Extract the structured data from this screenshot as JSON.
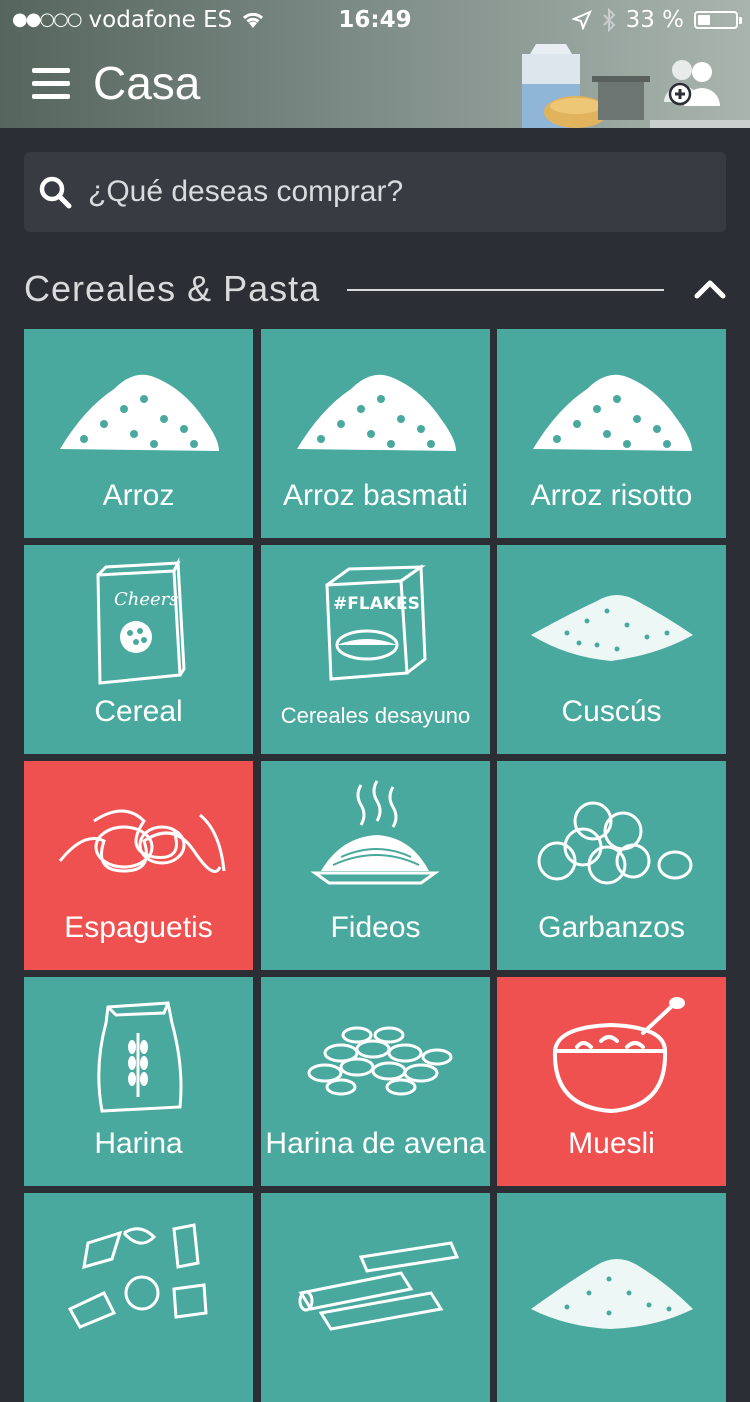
{
  "status_bar": {
    "carrier": "vodafone ES",
    "time": "16:49",
    "battery": "33 %",
    "battery_level": 0.33
  },
  "header": {
    "title": "Casa"
  },
  "search": {
    "placeholder": "¿Qué deseas comprar?"
  },
  "section": {
    "title": "Cereales & Pasta"
  },
  "items": [
    {
      "label": "Arroz",
      "color": "#4aa99e",
      "icon": "rice-pile-icon"
    },
    {
      "label": "Arroz basmati",
      "color": "#4aa99e",
      "icon": "rice-pile-icon"
    },
    {
      "label": "Arroz risotto",
      "color": "#4aa99e",
      "icon": "rice-pile-icon"
    },
    {
      "label": "Cereal",
      "color": "#4aa99e",
      "icon": "cereal-box-icon"
    },
    {
      "label": "Cereales desayuno",
      "color": "#4aa99e",
      "icon": "flakes-box-icon"
    },
    {
      "label": "Cuscús",
      "color": "#4aa99e",
      "icon": "couscous-pile-icon"
    },
    {
      "label": "Espaguetis",
      "color": "#ef5151",
      "icon": "spaghetti-icon"
    },
    {
      "label": "Fideos",
      "color": "#4aa99e",
      "icon": "noodle-plate-icon"
    },
    {
      "label": "Garbanzos",
      "color": "#4aa99e",
      "icon": "chickpeas-icon"
    },
    {
      "label": "Harina",
      "color": "#4aa99e",
      "icon": "flour-bag-icon"
    },
    {
      "label": "Harina de avena",
      "color": "#4aa99e",
      "icon": "oat-flakes-icon"
    },
    {
      "label": "Muesli",
      "color": "#ef5151",
      "icon": "bowl-spoon-icon"
    },
    {
      "label": "",
      "color": "#4aa99e",
      "icon": "pasta-shapes-icon"
    },
    {
      "label": "",
      "color": "#4aa99e",
      "icon": "penne-icon"
    },
    {
      "label": "",
      "color": "#4aa99e",
      "icon": "grain-pile-icon"
    }
  ]
}
